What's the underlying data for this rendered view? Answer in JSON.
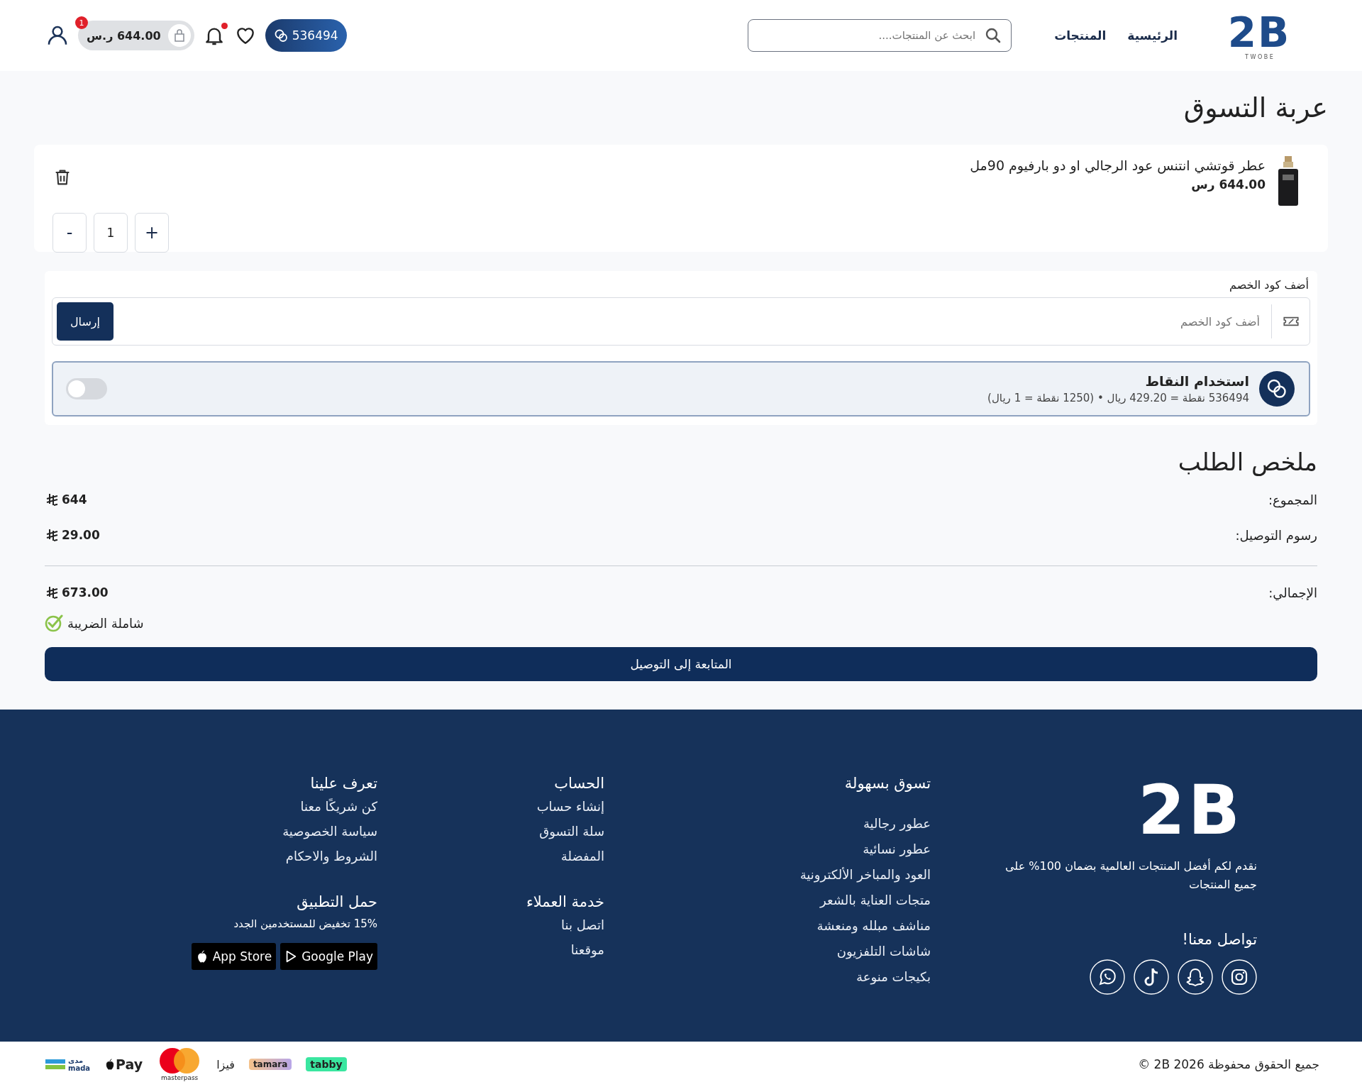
{
  "header": {
    "logo": {
      "mark": "2B",
      "tagline": "T W O B E"
    },
    "nav": [
      {
        "label": "الرئيسية"
      },
      {
        "label": "المنتجات"
      }
    ],
    "search": {
      "placeholder": "ابحث عن المنتجات...."
    },
    "points": "536494",
    "wishlist": {
      "kind": "heart"
    },
    "notifications": {
      "unread": true
    },
    "cart": {
      "total": "644.00 ر.س",
      "count": "1"
    }
  },
  "page_title": "عربة التسوق",
  "cart_items": [
    {
      "name": "عطر قوتشي انتنس عود الرجالي او دو بارفيوم 90مل",
      "price": "644.00 رس",
      "quantity": "1",
      "increase": "+",
      "decrease": "-"
    }
  ],
  "coupon": {
    "label": "أضف كود الخصم",
    "placeholder": "أضف كود الخصم",
    "submit": "إرسال"
  },
  "points_option": {
    "title": "استخدام النقاط",
    "details": "536494 نقطة = 429.20 ريال • (1250 نقطة = 1 ريال)",
    "on": false
  },
  "summary": {
    "title": "ملخص الطلب",
    "rows": [
      {
        "label": "المجموع:",
        "value": "644"
      },
      {
        "label": "رسوم التوصيل:",
        "value": "29.00"
      }
    ],
    "total": {
      "label": "الإجمالي:",
      "value": "673.00"
    },
    "tax_note": "شاملة الضريبة",
    "checkout": "المتابعة إلى التوصيل"
  },
  "footer": {
    "logo": "2B",
    "tagline": "نقدم لكم أفضل المنتجات العالمية بضمان 100% على جميع المنتجات",
    "social_title": "تواصل معنا!",
    "social": [
      {
        "kind": "instagram"
      },
      {
        "kind": "snapchat"
      },
      {
        "kind": "tiktok"
      },
      {
        "kind": "whatsapp"
      }
    ],
    "shop": {
      "title": "تسوق بسهولة",
      "links": [
        "عطور رجالية",
        "عطور نسائية",
        "العود والمباخر الألكترونية",
        "متجات العناية بالشعر",
        "مناشف مبلله ومنعشة",
        "شاشات التلفزيون",
        "بكيجات منوعة"
      ]
    },
    "account": {
      "title": "الحساب",
      "links": [
        "إنشاء حساب",
        "سلة التسوق",
        "المفضلة"
      ]
    },
    "support": {
      "title": "خدمة العملاء",
      "links": [
        "اتصل بنا",
        "موقعنا"
      ]
    },
    "about": {
      "title": "تعرف علينا",
      "links": [
        "كن شريكًا معنا",
        "سياسة الخصوصية",
        "الشروط والاحكام"
      ]
    },
    "app": {
      "title": "حمل التطبيق",
      "promo": "15% تخفيض للمستخدمين الجدد",
      "stores": [
        {
          "kind": "google",
          "label": "Google Play"
        },
        {
          "kind": "apple",
          "label": "App Store"
        }
      ]
    }
  },
  "bottom": {
    "copyright": "جميع الحقوق محفوظة 2B 2026 ©",
    "payments": [
      {
        "kind": "tabby",
        "label": "tabby"
      },
      {
        "kind": "tamara",
        "label": "tamara"
      },
      {
        "kind": "visa",
        "label": "فيزا"
      },
      {
        "kind": "mastercard",
        "label": "masterpass"
      },
      {
        "kind": "applepay",
        "label": "Pay"
      },
      {
        "kind": "mada",
        "label": "مدى",
        "sub": "mada"
      }
    ]
  }
}
